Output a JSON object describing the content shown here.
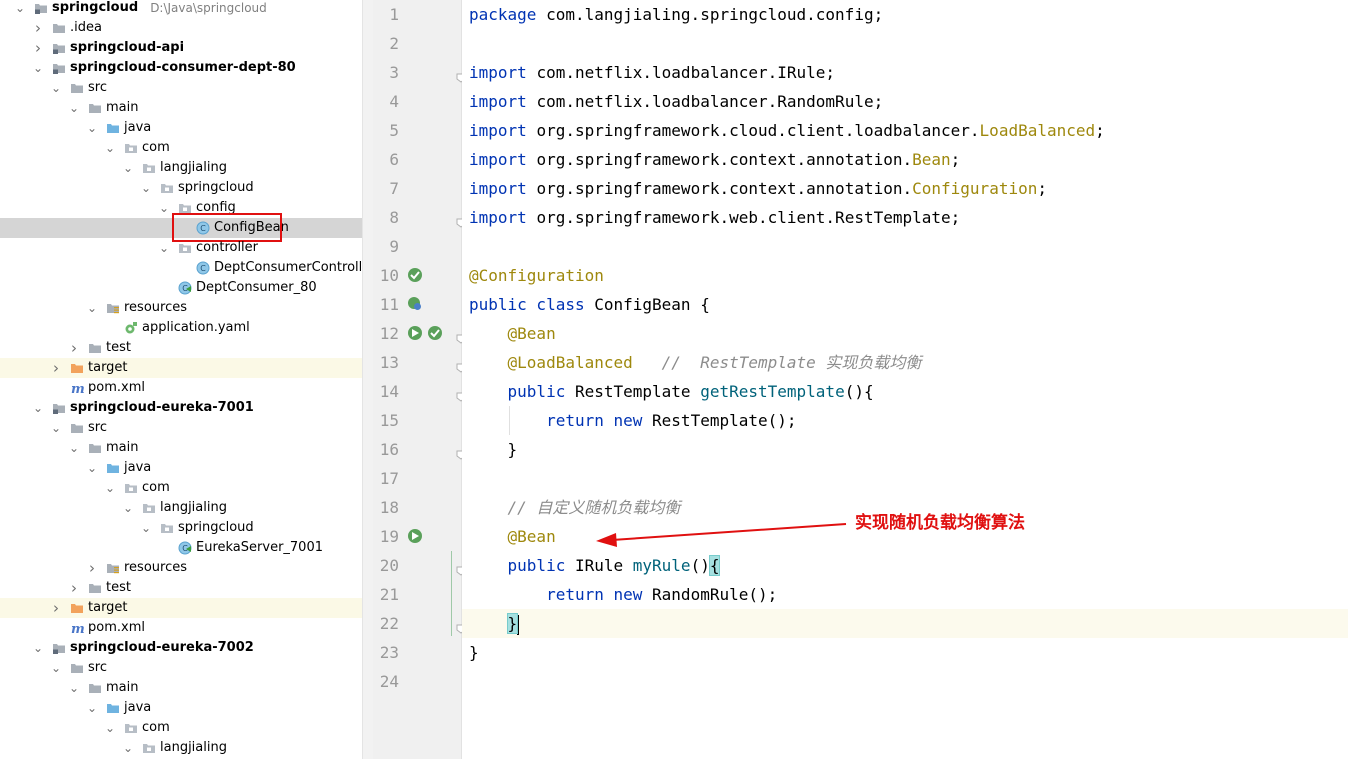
{
  "project_tree": {
    "rows": [
      {
        "depth": 0,
        "arrow": "down",
        "icon": "module",
        "label": "springcloud",
        "bold": true,
        "path": "D:\\Java\\springcloud"
      },
      {
        "depth": 1,
        "arrow": "right",
        "icon": "folder",
        "label": ".idea"
      },
      {
        "depth": 1,
        "arrow": "right",
        "icon": "module",
        "label": "springcloud-api",
        "bold": true
      },
      {
        "depth": 1,
        "arrow": "down",
        "icon": "module",
        "label": "springcloud-consumer-dept-80",
        "bold": true
      },
      {
        "depth": 2,
        "arrow": "down",
        "icon": "folder",
        "label": "src"
      },
      {
        "depth": 3,
        "arrow": "down",
        "icon": "folder",
        "label": "main"
      },
      {
        "depth": 4,
        "arrow": "down",
        "icon": "src-folder",
        "label": "java"
      },
      {
        "depth": 5,
        "arrow": "down",
        "icon": "package",
        "label": "com"
      },
      {
        "depth": 6,
        "arrow": "down",
        "icon": "package",
        "label": "langjialing"
      },
      {
        "depth": 7,
        "arrow": "down",
        "icon": "package",
        "label": "springcloud"
      },
      {
        "depth": 8,
        "arrow": "down",
        "icon": "package",
        "label": "config"
      },
      {
        "depth": 9,
        "arrow": "none",
        "icon": "class",
        "label": "ConfigBean",
        "selected": true,
        "highlight": true
      },
      {
        "depth": 8,
        "arrow": "down",
        "icon": "package",
        "label": "controller"
      },
      {
        "depth": 9,
        "arrow": "none",
        "icon": "class",
        "label": "DeptConsumerController"
      },
      {
        "depth": 8,
        "arrow": "none",
        "icon": "spring-class",
        "label": "DeptConsumer_80"
      },
      {
        "depth": 4,
        "arrow": "down",
        "icon": "res-folder",
        "label": "resources"
      },
      {
        "depth": 5,
        "arrow": "none",
        "icon": "yaml",
        "label": "application.yaml"
      },
      {
        "depth": 3,
        "arrow": "right",
        "icon": "folder",
        "label": "test"
      },
      {
        "depth": 2,
        "arrow": "right",
        "icon": "excluded-folder",
        "label": "target",
        "excluded": true
      },
      {
        "depth": 2,
        "arrow": "none",
        "icon": "maven",
        "label": "pom.xml"
      },
      {
        "depth": 1,
        "arrow": "down",
        "icon": "module",
        "label": "springcloud-eureka-7001",
        "bold": true
      },
      {
        "depth": 2,
        "arrow": "down",
        "icon": "folder",
        "label": "src"
      },
      {
        "depth": 3,
        "arrow": "down",
        "icon": "folder",
        "label": "main"
      },
      {
        "depth": 4,
        "arrow": "down",
        "icon": "src-folder",
        "label": "java"
      },
      {
        "depth": 5,
        "arrow": "down",
        "icon": "package",
        "label": "com"
      },
      {
        "depth": 6,
        "arrow": "down",
        "icon": "package",
        "label": "langjialing"
      },
      {
        "depth": 7,
        "arrow": "down",
        "icon": "package",
        "label": "springcloud"
      },
      {
        "depth": 8,
        "arrow": "none",
        "icon": "spring-class",
        "label": "EurekaServer_7001"
      },
      {
        "depth": 4,
        "arrow": "right",
        "icon": "res-folder",
        "label": "resources"
      },
      {
        "depth": 3,
        "arrow": "right",
        "icon": "folder",
        "label": "test"
      },
      {
        "depth": 2,
        "arrow": "right",
        "icon": "excluded-folder",
        "label": "target",
        "excluded": true
      },
      {
        "depth": 2,
        "arrow": "none",
        "icon": "maven",
        "label": "pom.xml"
      },
      {
        "depth": 1,
        "arrow": "down",
        "icon": "module",
        "label": "springcloud-eureka-7002",
        "bold": true
      },
      {
        "depth": 2,
        "arrow": "down",
        "icon": "folder",
        "label": "src"
      },
      {
        "depth": 3,
        "arrow": "down",
        "icon": "folder",
        "label": "main"
      },
      {
        "depth": 4,
        "arrow": "down",
        "icon": "src-folder",
        "label": "java"
      },
      {
        "depth": 5,
        "arrow": "down",
        "icon": "package",
        "label": "com"
      },
      {
        "depth": 6,
        "arrow": "down",
        "icon": "package",
        "label": "langjialing"
      }
    ]
  },
  "editor": {
    "lines": [
      {
        "n": "1",
        "t": [
          [
            "kw",
            "package "
          ],
          [
            "",
            "com.langjialing.springcloud.config;"
          ]
        ]
      },
      {
        "n": "2",
        "t": []
      },
      {
        "n": "3",
        "fold": true,
        "t": [
          [
            "kw",
            "import "
          ],
          [
            "",
            "com.netflix.loadbalancer.IRule;"
          ]
        ]
      },
      {
        "n": "4",
        "t": [
          [
            "kw",
            "import "
          ],
          [
            "",
            "com.netflix.loadbalancer.RandomRule;"
          ]
        ]
      },
      {
        "n": "5",
        "t": [
          [
            "kw",
            "import "
          ],
          [
            "",
            "org.springframework.cloud.client.loadbalancer."
          ],
          [
            "an",
            "LoadBalanced"
          ],
          [
            "",
            ";"
          ]
        ]
      },
      {
        "n": "6",
        "t": [
          [
            "kw",
            "import "
          ],
          [
            "",
            "org.springframework.context.annotation."
          ],
          [
            "an",
            "Bean"
          ],
          [
            "",
            ";"
          ]
        ]
      },
      {
        "n": "7",
        "t": [
          [
            "kw",
            "import "
          ],
          [
            "",
            "org.springframework.context.annotation."
          ],
          [
            "an",
            "Configuration"
          ],
          [
            "",
            ";"
          ]
        ]
      },
      {
        "n": "8",
        "fold": true,
        "t": [
          [
            "kw",
            "import "
          ],
          [
            "",
            "org.springframework.web.client.RestTemplate;"
          ]
        ]
      },
      {
        "n": "9",
        "t": []
      },
      {
        "n": "10",
        "marks": [
          "bean-check"
        ],
        "t": [
          [
            "an",
            "@Configuration"
          ]
        ]
      },
      {
        "n": "11",
        "marks": [
          "bean-search"
        ],
        "t": [
          [
            "kw",
            "public class "
          ],
          [
            "",
            "ConfigBean {"
          ]
        ]
      },
      {
        "n": "12",
        "marks": [
          "bean-run",
          "bean-check"
        ],
        "fold": true,
        "t": [
          [
            "",
            "    "
          ],
          [
            "an",
            "@Bean"
          ]
        ]
      },
      {
        "n": "13",
        "fold": true,
        "t": [
          [
            "",
            "    "
          ],
          [
            "an",
            "@LoadBalanced"
          ],
          [
            "",
            "   "
          ],
          [
            "cm",
            "//  RestTemplate 实现负载均衡"
          ]
        ]
      },
      {
        "n": "14",
        "fold": true,
        "t": [
          [
            "",
            "    "
          ],
          [
            "kw",
            "public "
          ],
          [
            "",
            "RestTemplate "
          ],
          [
            "fn",
            "getRestTemplate"
          ],
          [
            "",
            "(){"
          ]
        ]
      },
      {
        "n": "15",
        "t": [
          [
            "",
            "        "
          ],
          [
            "kw",
            "return new "
          ],
          [
            "",
            "RestTemplate();"
          ]
        ]
      },
      {
        "n": "16",
        "fold": true,
        "t": [
          [
            "",
            "    }"
          ]
        ]
      },
      {
        "n": "17",
        "t": []
      },
      {
        "n": "18",
        "t": [
          [
            "",
            "    "
          ],
          [
            "cm",
            "// 自定义随机负载均衡"
          ]
        ]
      },
      {
        "n": "19",
        "marks": [
          "bean-run"
        ],
        "t": [
          [
            "",
            "    "
          ],
          [
            "an",
            "@Bean"
          ]
        ]
      },
      {
        "n": "20",
        "fold": true,
        "t": [
          [
            "",
            "    "
          ],
          [
            "kw",
            "public "
          ],
          [
            "",
            "IRule "
          ],
          [
            "fn",
            "myRule"
          ],
          [
            "",
            "()"
          ],
          [
            "brace",
            "{"
          ]
        ]
      },
      {
        "n": "21",
        "t": [
          [
            "",
            "        "
          ],
          [
            "kw",
            "return new "
          ],
          [
            "",
            "RandomRule();"
          ]
        ]
      },
      {
        "n": "22",
        "fold": true,
        "current": true,
        "t": [
          [
            "",
            "    "
          ],
          [
            "brace",
            "}"
          ],
          [
            "caret",
            ""
          ]
        ]
      },
      {
        "n": "23",
        "t": [
          [
            "",
            "}"
          ]
        ]
      },
      {
        "n": "24",
        "t": []
      }
    ]
  },
  "annotation": {
    "text": "实现随机负载均衡算法",
    "color": "#e01010"
  },
  "colors": {
    "keyword": "#0033b3",
    "annotation": "#9e880d",
    "comment": "#8c8c8c",
    "method": "#00627a",
    "selection": "#d5d5d5"
  }
}
